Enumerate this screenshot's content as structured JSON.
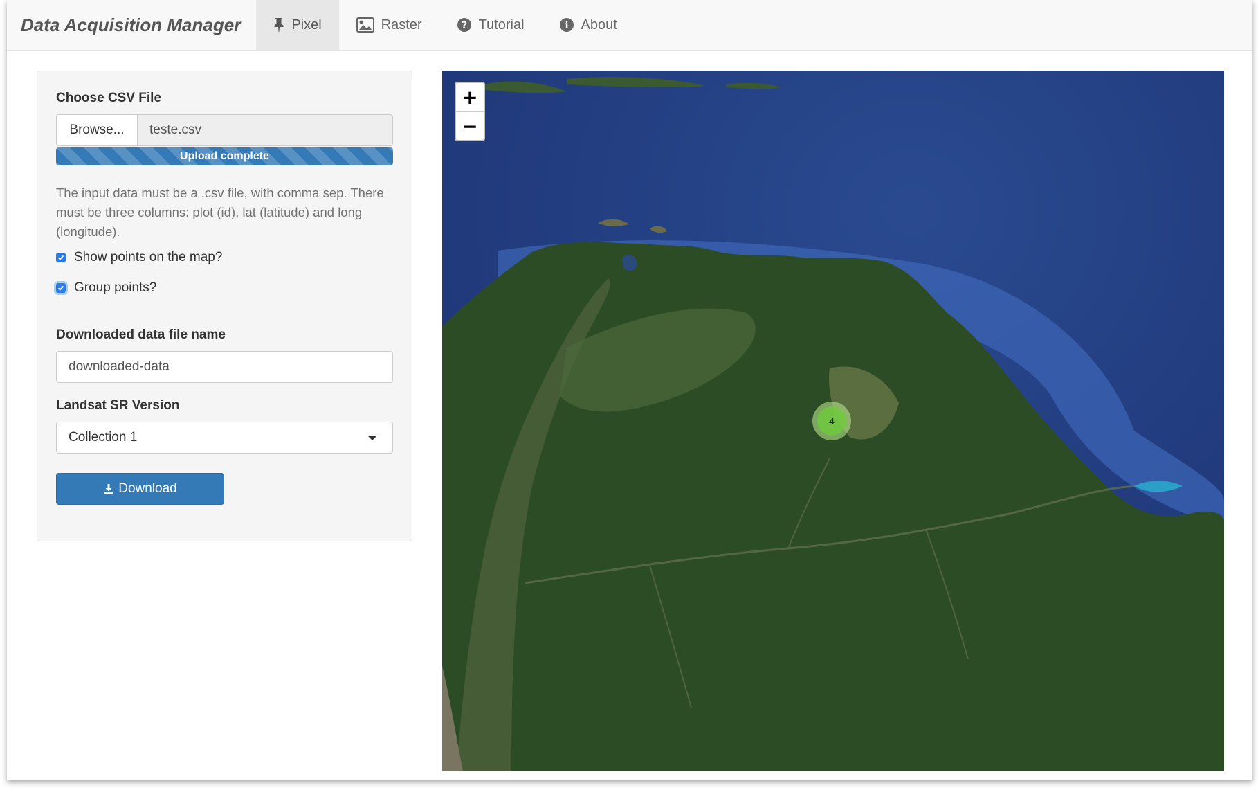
{
  "app": {
    "title": "Data Acquisition Manager"
  },
  "nav": {
    "tabs": [
      {
        "label": "Pixel",
        "icon": "pin-icon",
        "active": true
      },
      {
        "label": "Raster",
        "icon": "image-icon",
        "active": false
      },
      {
        "label": "Tutorial",
        "icon": "question-circle-icon",
        "active": false
      },
      {
        "label": "About",
        "icon": "info-circle-icon",
        "active": false
      }
    ]
  },
  "sidebar": {
    "csv": {
      "label": "Choose CSV File",
      "browse_label": "Browse...",
      "file_name": "teste.csv",
      "progress_text": "Upload complete",
      "progress_percent": 100
    },
    "help_text": "The input data must be a .csv file, with comma sep. There must be three columns: plot (id), lat (latitude) and long (longitude).",
    "show_points": {
      "label": "Show points on the map?",
      "checked": true
    },
    "group_points": {
      "label": "Group points?",
      "checked": true
    },
    "filename": {
      "label": "Downloaded data file name",
      "value": "downloaded-data"
    },
    "landsat": {
      "label": "Landsat SR Version",
      "selected": "Collection 1"
    },
    "download_label": "Download"
  },
  "map": {
    "zoom_in": "+",
    "zoom_out": "−",
    "cluster_count": "4"
  },
  "colors": {
    "primary": "#337ab7",
    "checkbox": "#2f7ae5",
    "ocean": "#1e3a7a",
    "land": "#2c4c26",
    "cluster": "#6ecc39"
  }
}
